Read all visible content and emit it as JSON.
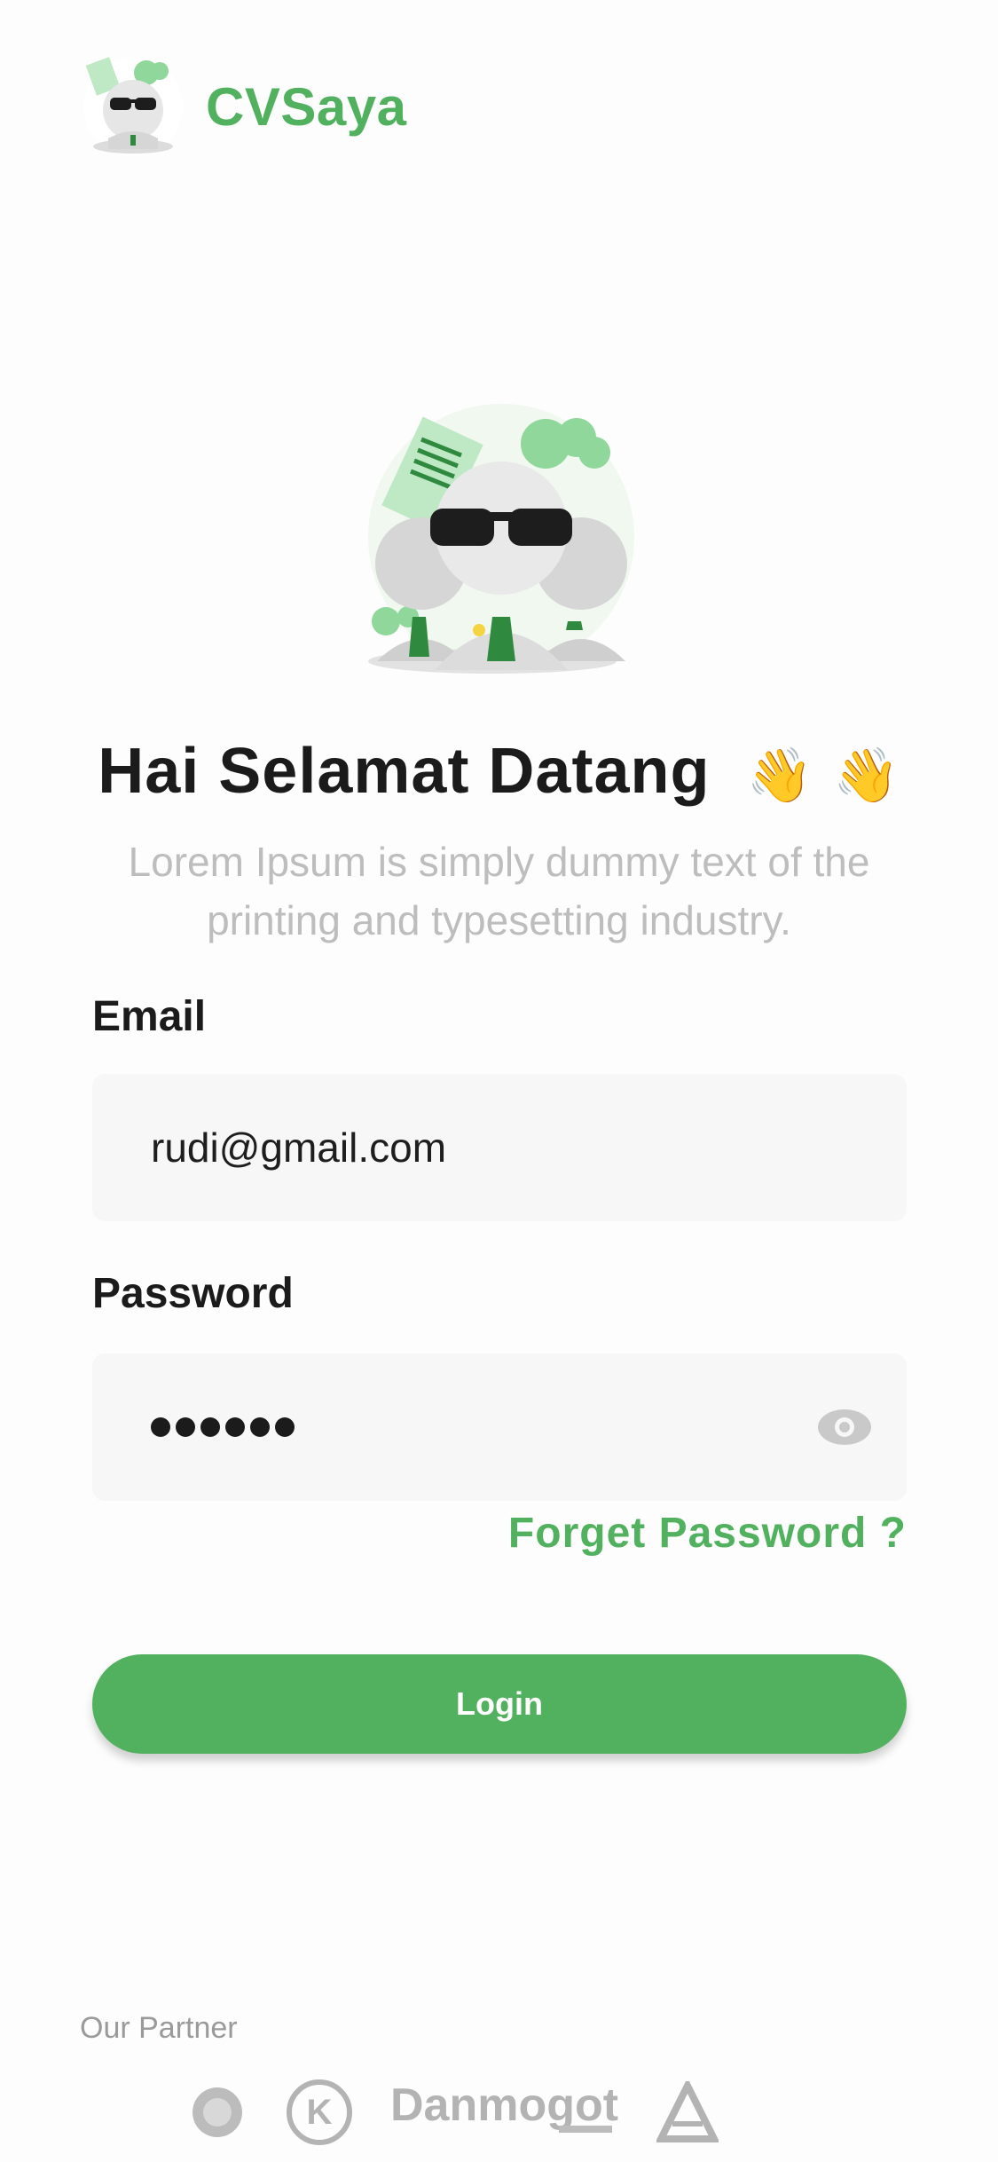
{
  "app": {
    "name": "CVSaya"
  },
  "hero": {
    "title": "Hai Selamat Datang",
    "emoji": "👋 👋",
    "subtitle": "Lorem Ipsum is simply dummy text of the printing and typesetting industry."
  },
  "form": {
    "email_label": "Email",
    "email_value": "rudi@gmail.com",
    "password_label": "Password",
    "password_masked": "••••••",
    "forgot_label": "Forget Password ?",
    "login_label": "Login"
  },
  "partners": {
    "label": "Our Partner",
    "logos": [
      "partner-1",
      "partner-K",
      "Danmogot",
      "partner-A"
    ]
  },
  "colors": {
    "accent": "#52b15f",
    "text": "#1b1b1b",
    "muted": "#bdbdbd",
    "field_bg": "#f7f7f7"
  }
}
